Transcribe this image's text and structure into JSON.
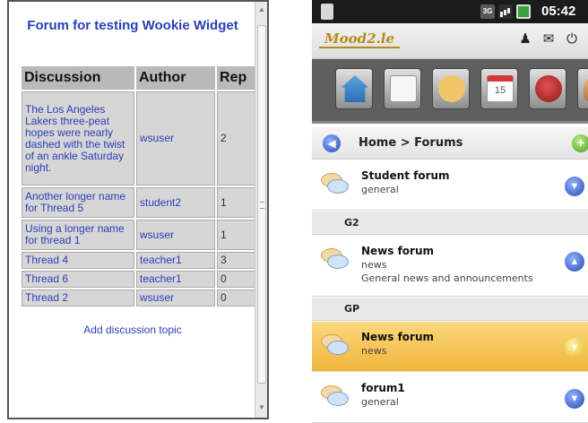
{
  "widget": {
    "title": "Forum for testing Wookie Widget",
    "columns": [
      "Discussion",
      "Author",
      "Rep"
    ],
    "threads": [
      {
        "title": "The Los Angeles Lakers three-peat hopes were nearly dashed with the twist of an ankle Saturday night.",
        "author": "wsuser",
        "replies": "2"
      },
      {
        "title": "Another longer name for Thread 5",
        "author": "student2",
        "replies": "1"
      },
      {
        "title": "Using a longer name for thread 1",
        "author": "wsuser",
        "replies": "1"
      },
      {
        "title": "Thread 4",
        "author": "teacher1",
        "replies": "3"
      },
      {
        "title": "Thread 6",
        "author": "teacher1",
        "replies": "0"
      },
      {
        "title": "Thread 2",
        "author": "wsuser",
        "replies": "0"
      }
    ],
    "add_topic": "Add discussion topic"
  },
  "phone": {
    "status": {
      "time": "05:42",
      "network": "3G"
    },
    "app_logo": "Mood2.le",
    "top_icons": [
      "person-icon",
      "mail-icon",
      "power-icon"
    ],
    "nav_tiles": [
      "home-icon",
      "page-icon",
      "chat-icon",
      "calendar-icon",
      "badge-icon",
      "person-icon"
    ],
    "calendar_day": "15",
    "breadcrumb": "Home > Forums",
    "forums": [
      {
        "name": "Student forum",
        "type": "general",
        "desc": ""
      },
      {
        "group": "G2"
      },
      {
        "name": "News forum",
        "type": "news",
        "desc": "General news and announcements"
      },
      {
        "group": "GP"
      },
      {
        "name": "News forum",
        "type": "news",
        "desc": "",
        "selected": true
      },
      {
        "name": "forum1",
        "type": "general",
        "desc": ""
      }
    ],
    "colors": {
      "selected": "#f0b53a",
      "link": "#2a3fb8"
    }
  }
}
